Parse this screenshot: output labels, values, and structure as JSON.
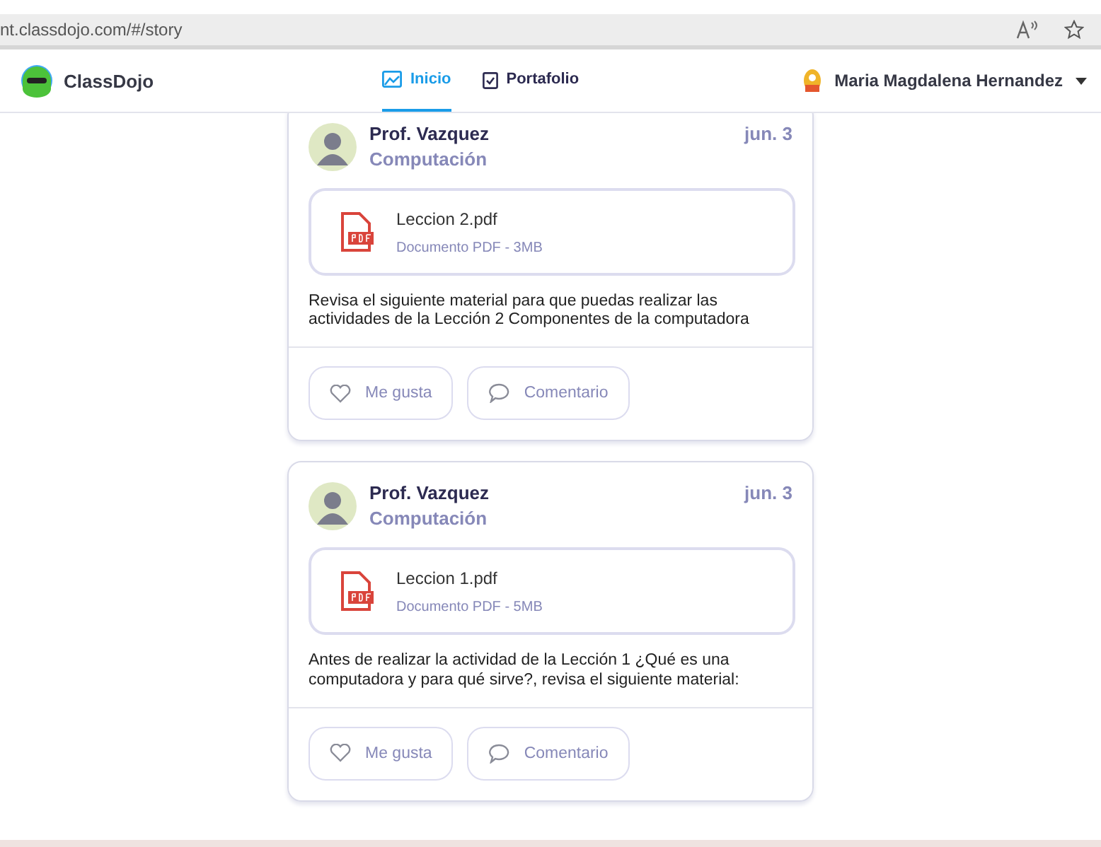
{
  "browser": {
    "url": "nt.classdojo.com/#/story"
  },
  "nav": {
    "brand": "ClassDojo",
    "tabs": [
      {
        "label": "Inicio",
        "selected": true,
        "kind": "home"
      },
      {
        "label": "Portafolio",
        "selected": false,
        "kind": "portfolio"
      }
    ],
    "user": "Maria Magdalena Hernandez"
  },
  "posts": [
    {
      "author": "Prof. Vazquez",
      "class": "Computación",
      "date": "jun. 3",
      "file": {
        "name": "Leccion 2.pdf",
        "meta": "Documento PDF - 3MB"
      },
      "text": "Revisa el siguiente material para que puedas realizar las actividades de la Lección 2 Componentes de la computadora",
      "actions": [
        "Me gusta",
        "Comentario"
      ]
    },
    {
      "author": "Prof. Vazquez",
      "class": "Computación",
      "date": "jun. 3",
      "file": {
        "name": "Leccion 1.pdf",
        "meta": "Documento PDF - 5MB"
      },
      "text": "Antes de realizar la actividad de la Lección 1 ¿Qué es una computadora y para qué sirve?, revisa el siguiente material:",
      "actions": [
        "Me gusta",
        "Comentario"
      ]
    }
  ]
}
